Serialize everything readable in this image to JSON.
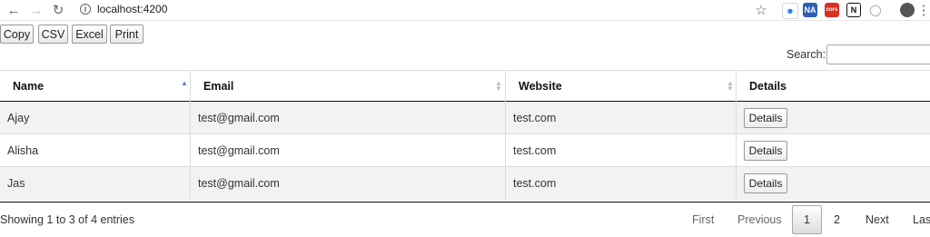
{
  "browser": {
    "url": "localhost:4200",
    "icons": [
      "back-icon",
      "forward-icon",
      "reload-icon",
      "info-icon",
      "star-icon",
      "extension-icon"
    ]
  },
  "toolbar": {
    "buttons": [
      "Copy",
      "CSV",
      "Excel",
      "Print"
    ],
    "search_label": "Search:",
    "search_value": ""
  },
  "table": {
    "columns": [
      "Name",
      "Email",
      "Website",
      "Details"
    ],
    "rows": [
      {
        "name": "Ajay",
        "email": "test@gmail.com",
        "website": "test.com",
        "details": "Details"
      },
      {
        "name": "Alisha",
        "email": "test@gmail.com",
        "website": "test.com",
        "details": "Details"
      },
      {
        "name": "Jas",
        "email": "test@gmail.com",
        "website": "test.com",
        "details": "Details"
      }
    ]
  },
  "footer": {
    "info": "Showing 1 to 3 of 4 entries",
    "pagination": {
      "first": "First",
      "previous": "Previous",
      "pages": [
        "1",
        "2"
      ],
      "next": "Next",
      "last": "Last"
    }
  }
}
